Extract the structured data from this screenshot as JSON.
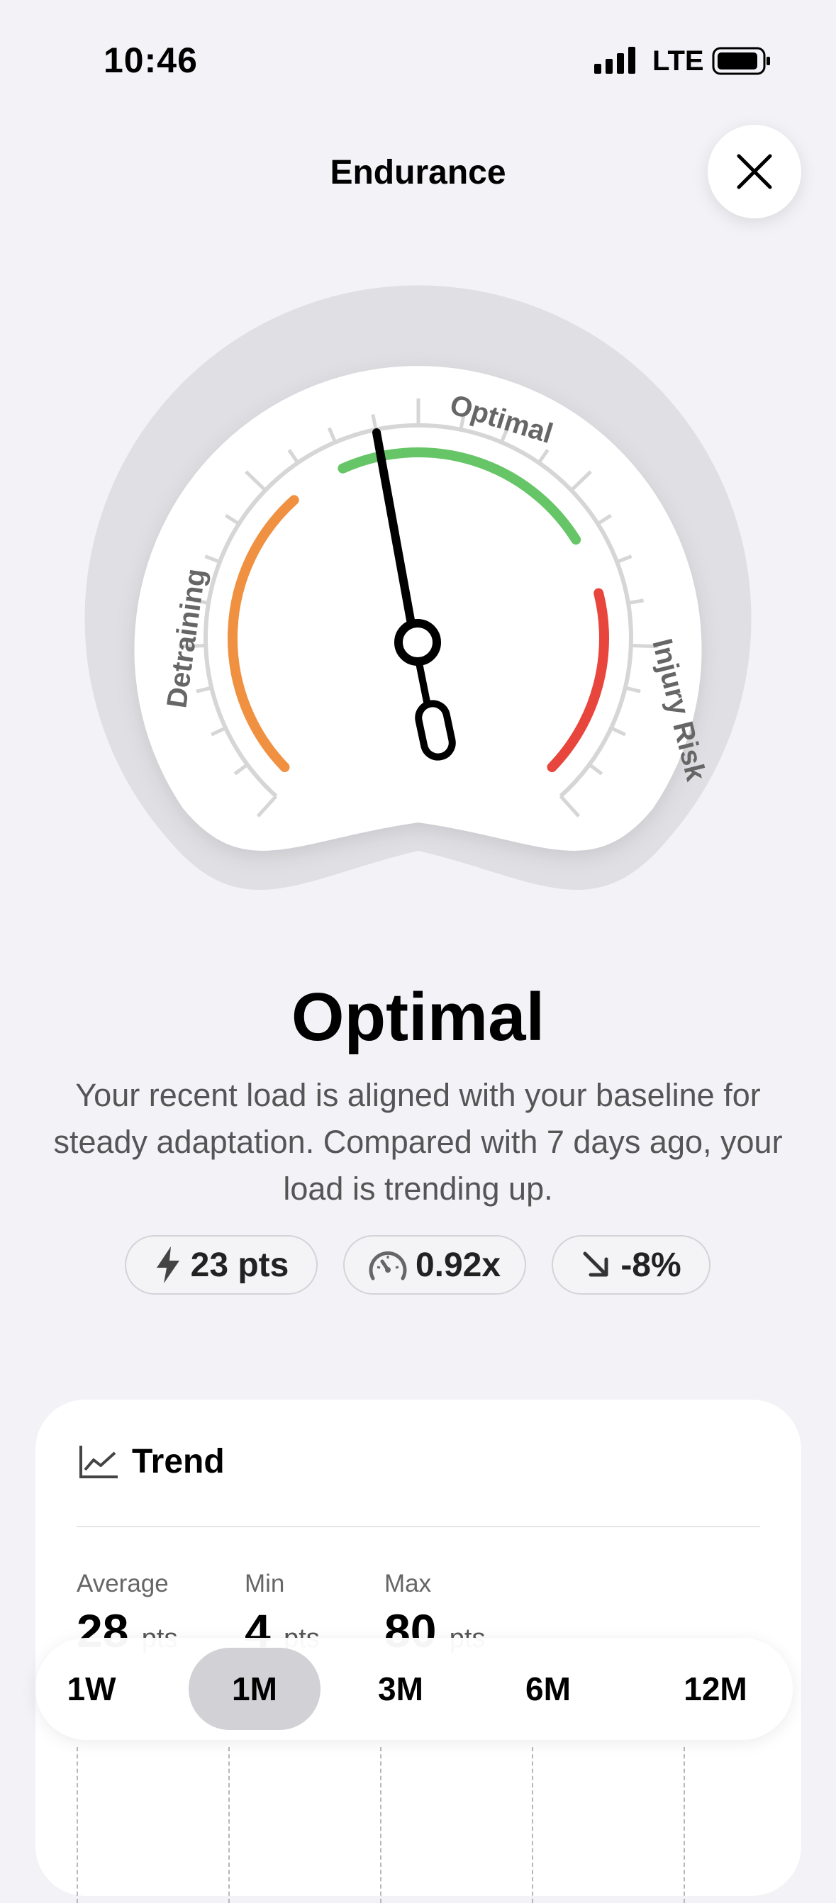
{
  "status_bar": {
    "time": "10:46",
    "network": "LTE"
  },
  "nav": {
    "title": "Endurance",
    "close_icon": "close-icon"
  },
  "gauge": {
    "labels": {
      "low": "Detraining",
      "mid": "Optimal",
      "high": "Injury Risk"
    },
    "colors": {
      "low": "#EF9140",
      "mid": "#66C566",
      "high": "#E8453C"
    }
  },
  "status": {
    "title": "Optimal",
    "description": "Your recent load is aligned with your baseline for steady adaptation. Compared with 7 days ago, your load is trending up."
  },
  "pills": [
    {
      "icon": "bolt-icon",
      "value": "23 pts"
    },
    {
      "icon": "gauge-icon",
      "value": "0.92x"
    },
    {
      "icon": "arrow-down-right-icon",
      "value": "-8%"
    }
  ],
  "trend": {
    "title": "Trend",
    "icon": "chart-line-icon",
    "average_label": "Average",
    "average_value": "28",
    "min_label": "Min",
    "min_value": "4",
    "max_label": "Max",
    "max_value": "80",
    "unit": "pts"
  },
  "range": {
    "options": [
      "1W",
      "1M",
      "3M",
      "6M",
      "12M"
    ],
    "selected": "1M"
  }
}
